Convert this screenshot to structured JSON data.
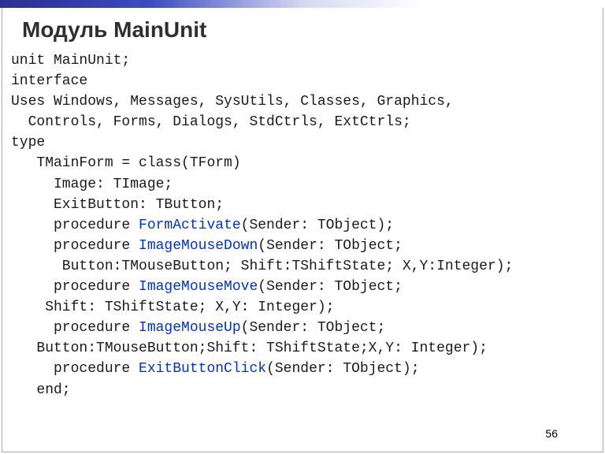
{
  "title": "Модуль MainUnit",
  "page_number": "56",
  "code": {
    "l01": "unit MainUnit;",
    "l02": "interface",
    "l03a": "Uses Windows, Messages, SysUtils, Classes, Graphics,",
    "l03b": "  Controls, Forms, Dialogs, StdCtrls, ExtCtrls;",
    "l04": "type",
    "l05": "   TMainForm = class(TForm)",
    "l06": "     Image: TImage;",
    "l07": "     ExitButton: TButton;",
    "l08a": "     procedure ",
    "l08b": "FormActivate",
    "l08c": "(Sender: TObject);",
    "l09a": "     procedure ",
    "l09b": "ImageMouseDown",
    "l09c": "(Sender: TObject;",
    "l10": "      Button:TMouseButton; Shift:TShiftState; X,Y:Integer);",
    "l11a": "     procedure ",
    "l11b": "ImageMouseMove",
    "l11c": "(Sender: TObject;",
    "l12": "    Shift: TShiftState; X,Y: Integer);",
    "l13a": "     procedure ",
    "l13b": "ImageMouseUp",
    "l13c": "(Sender: TObject;",
    "l14": "   Button:TMouseButton;Shift: TShiftState;X,Y: Integer);",
    "l15a": "     procedure ",
    "l15b": "ExitButtonClick",
    "l15c": "(Sender: TObject);",
    "l16": "   end;"
  }
}
